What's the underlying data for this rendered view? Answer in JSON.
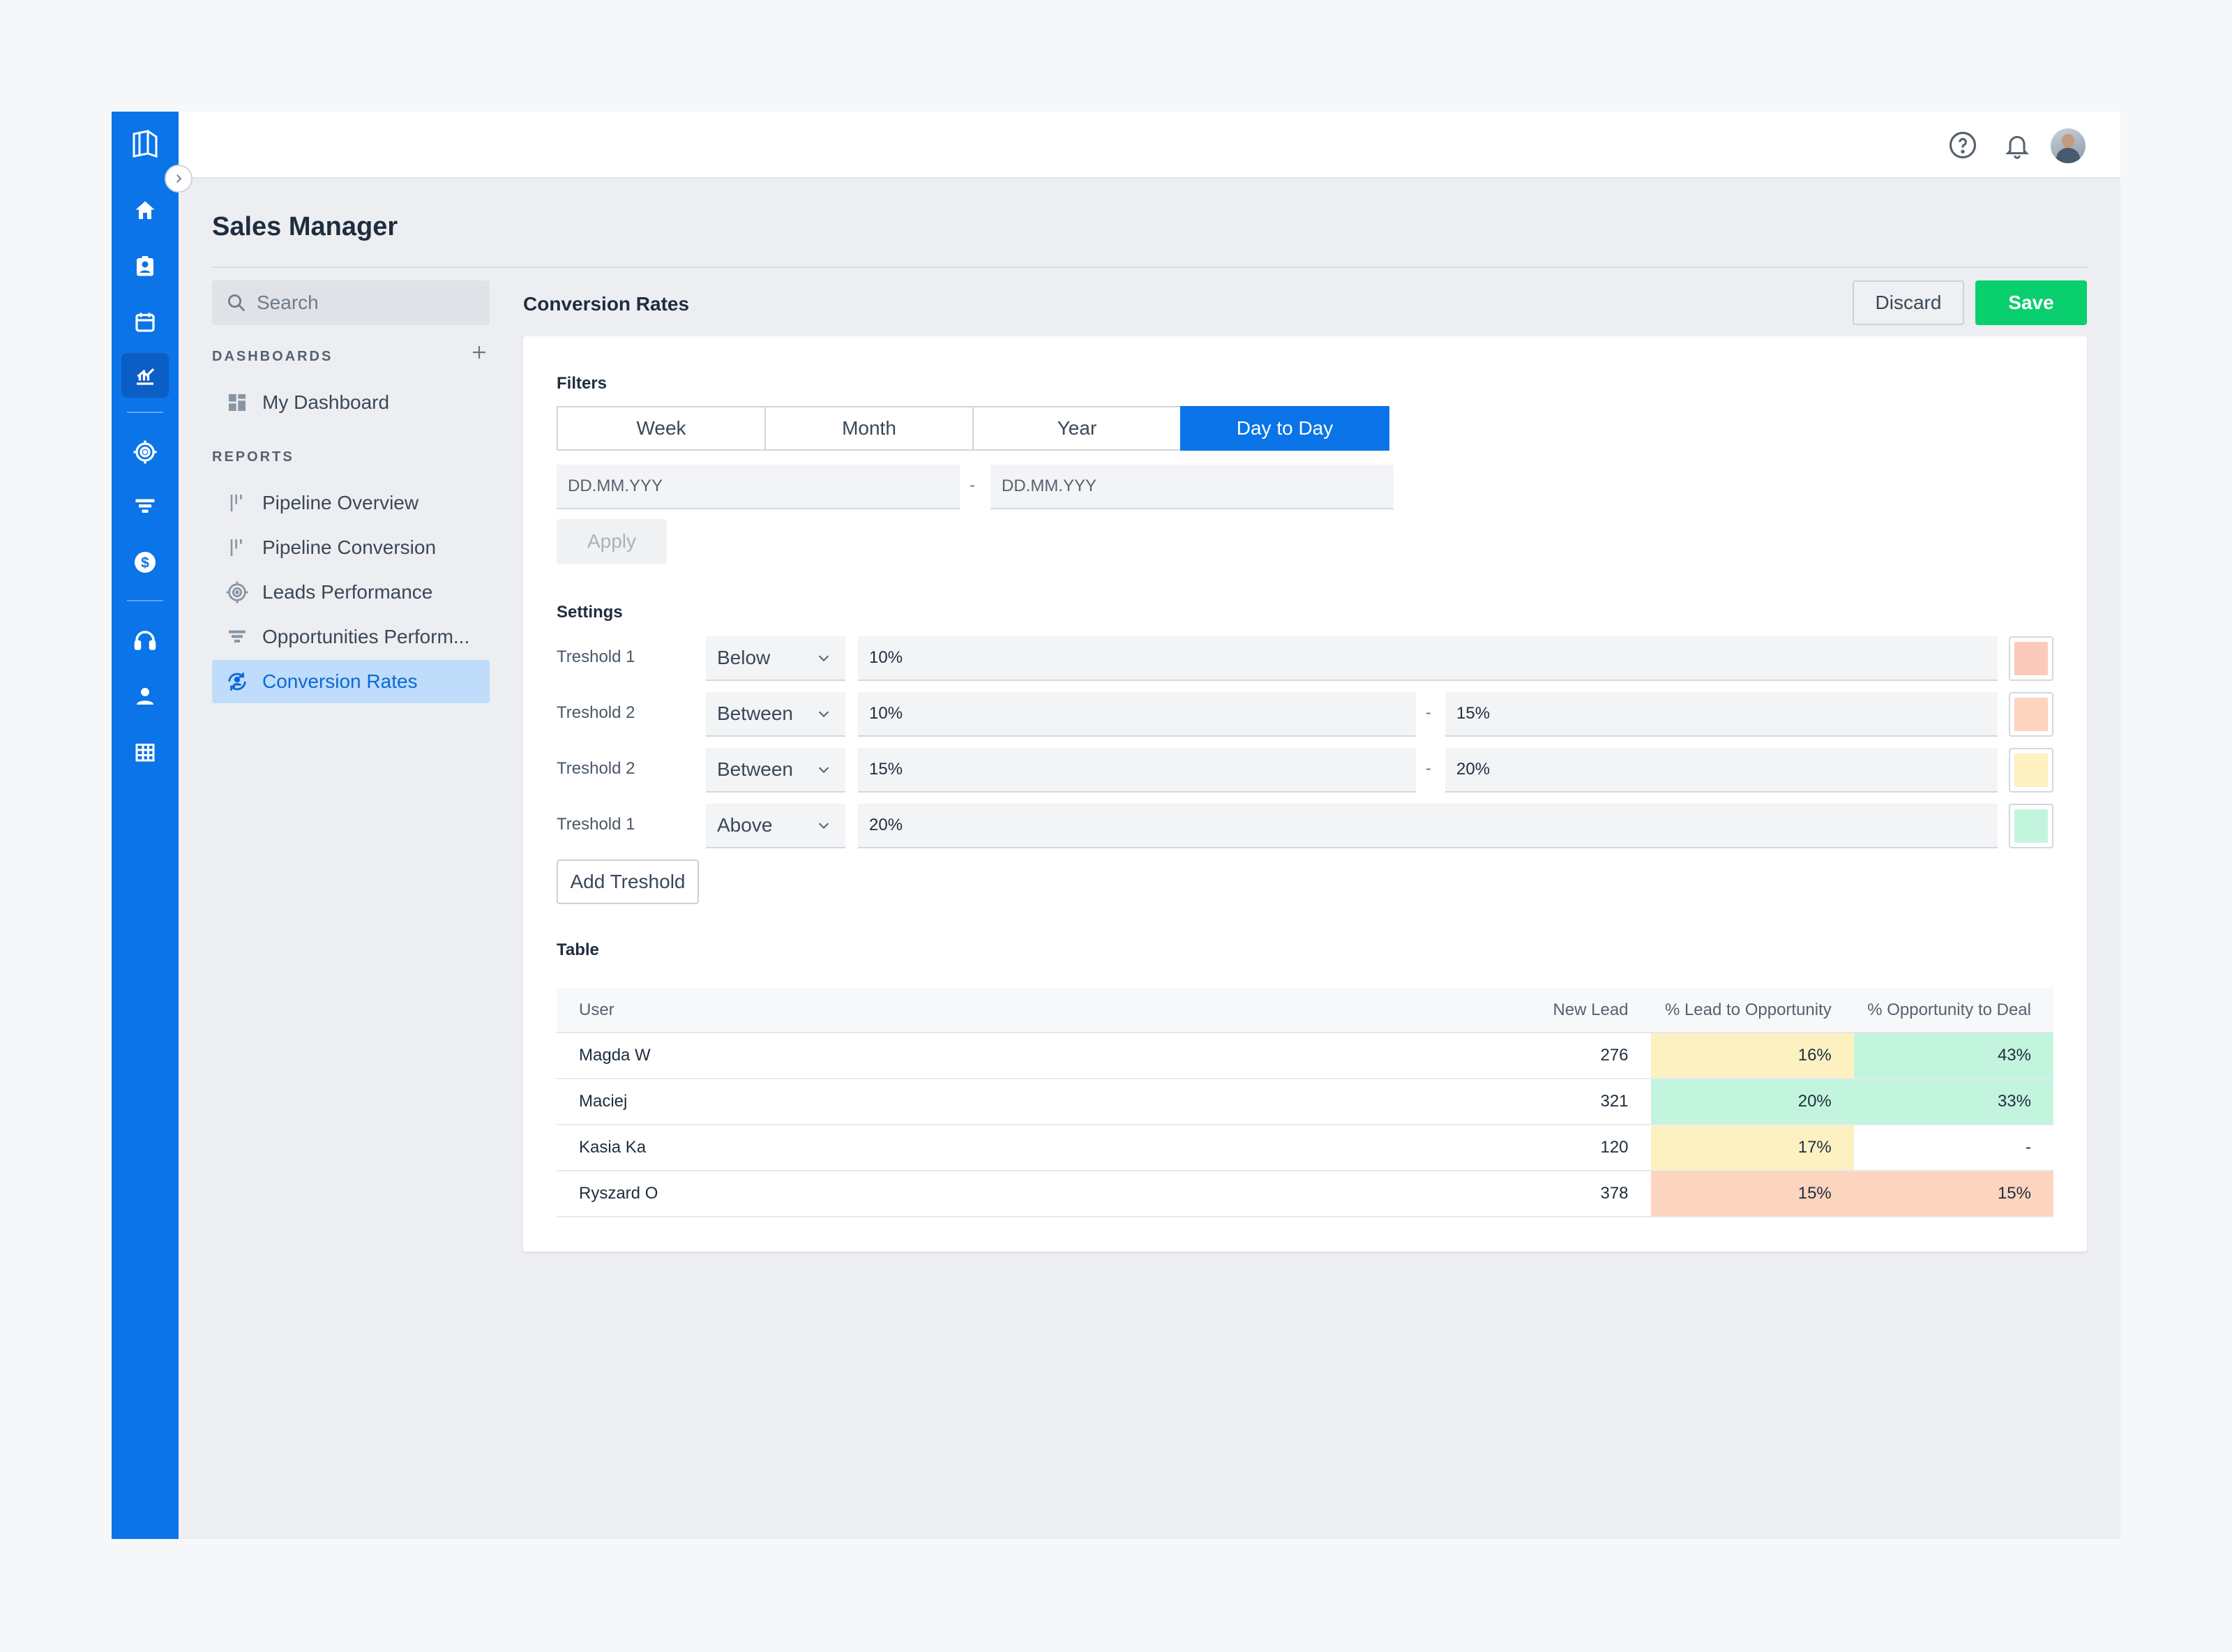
{
  "header": {
    "title": "Sales Manager"
  },
  "search": {
    "placeholder": "Search"
  },
  "sidebar": {
    "dashboards_label": "DASHBOARDS",
    "dashboards": [
      {
        "label": "My Dashboard",
        "icon": "grid-icon"
      }
    ],
    "reports_label": "REPORTS",
    "reports": [
      {
        "label": "Pipeline Overview",
        "icon": "pipeline-icon"
      },
      {
        "label": "Pipeline Conversion",
        "icon": "pipeline-icon"
      },
      {
        "label": "Leads Performance",
        "icon": "target-icon"
      },
      {
        "label": "Opportunities Perform...",
        "icon": "funnel-icon"
      },
      {
        "label": "Conversion Rates",
        "icon": "conversion-icon",
        "active": true
      }
    ]
  },
  "rail": {
    "items": [
      "home-icon",
      "contacts-icon",
      "calendar-icon",
      "reports-icon",
      "target-icon",
      "funnel-icon",
      "dollar-icon",
      "headset-icon",
      "user-icon",
      "building-icon"
    ],
    "active": "reports-icon"
  },
  "main": {
    "title": "Conversion Rates",
    "discard_label": "Discard",
    "save_label": "Save",
    "filters": {
      "label": "Filters",
      "tabs": [
        "Week",
        "Month",
        "Year",
        "Day to Day"
      ],
      "active_tab": "Day to Day",
      "date_from_placeholder": "DD.MM.YYY",
      "date_to_placeholder": "DD.MM.YYY",
      "separator": "-",
      "apply_label": "Apply"
    },
    "settings": {
      "label": "Settings",
      "thresholds": [
        {
          "label": "Treshold 1",
          "operator": "Below",
          "value1": "10%",
          "color": "#fbcabb"
        },
        {
          "label": "Treshold 2",
          "operator": "Between",
          "value1": "10%",
          "value2": "15%",
          "color": "#fdd4be"
        },
        {
          "label": "Treshold 2",
          "operator": "Between",
          "value1": "15%",
          "value2": "20%",
          "color": "#fdf1c2"
        },
        {
          "label": "Treshold 1",
          "operator": "Above",
          "value1": "20%",
          "color": "#c3f5de"
        }
      ],
      "add_label": "Add Treshold"
    },
    "table": {
      "label": "Table",
      "columns": [
        "User",
        "New Lead",
        "% Lead to Opportunity",
        "% Opportunity to Deal"
      ],
      "rows": [
        {
          "user": "Magda W",
          "new_lead": "276",
          "lead_to_opp": "16%",
          "opp_to_deal": "43%"
        },
        {
          "user": "Maciej",
          "new_lead": "321",
          "lead_to_opp": "20%",
          "opp_to_deal": "33%"
        },
        {
          "user": "Kasia Ka",
          "new_lead": "120",
          "lead_to_opp": "17%",
          "opp_to_deal": "-"
        },
        {
          "user": "Ryszard O",
          "new_lead": "378",
          "lead_to_opp": "15%",
          "opp_to_deal": "15%"
        }
      ]
    }
  },
  "colors": {
    "brand": "#0a74e8",
    "save": "#0acf6e",
    "low": "#fbcabb",
    "mid_low": "#fdd4be",
    "mid_high": "#fdf1c2",
    "high": "#c3f5de"
  }
}
